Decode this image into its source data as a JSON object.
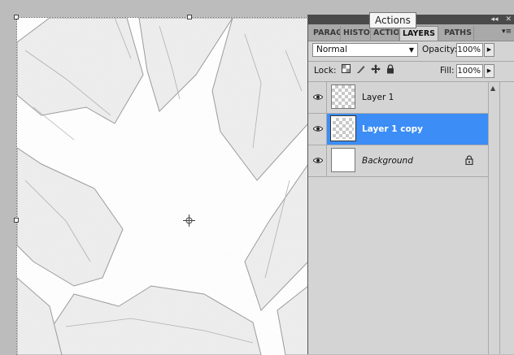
{
  "tooltip": "Actions",
  "panel": {
    "tabs": [
      {
        "label": "PARAGRAPH",
        "display": "PARAG"
      },
      {
        "label": "HISTORY",
        "display": "HISTO"
      },
      {
        "label": "ACTIONS",
        "display": "ACTIO"
      },
      {
        "label": "LAYERS",
        "display": "LAYERS",
        "active": true
      },
      {
        "label": "PATHS",
        "display": "PATHS"
      }
    ],
    "controls": {
      "collapse": "◂◂",
      "close": "✕",
      "menu": "▾≡"
    }
  },
  "blend": {
    "mode": "Normal",
    "arrow": "▼"
  },
  "opacity": {
    "label": "Opacity:",
    "value": "100%"
  },
  "lock": {
    "label": "Lock:"
  },
  "fill": {
    "label": "Fill:",
    "value": "100%"
  },
  "layers": [
    {
      "name": "Layer 1",
      "visible": true,
      "selected": false,
      "thumbnail": "transparent"
    },
    {
      "name": "Layer 1 copy",
      "visible": true,
      "selected": true,
      "thumbnail": "transparent"
    },
    {
      "name": "Background",
      "visible": true,
      "selected": false,
      "thumbnail": "white",
      "locked": true
    }
  ],
  "colors": {
    "selection": "#3c8df5",
    "panel": "#d4d4d4",
    "workspace": "#bcbcbc"
  }
}
